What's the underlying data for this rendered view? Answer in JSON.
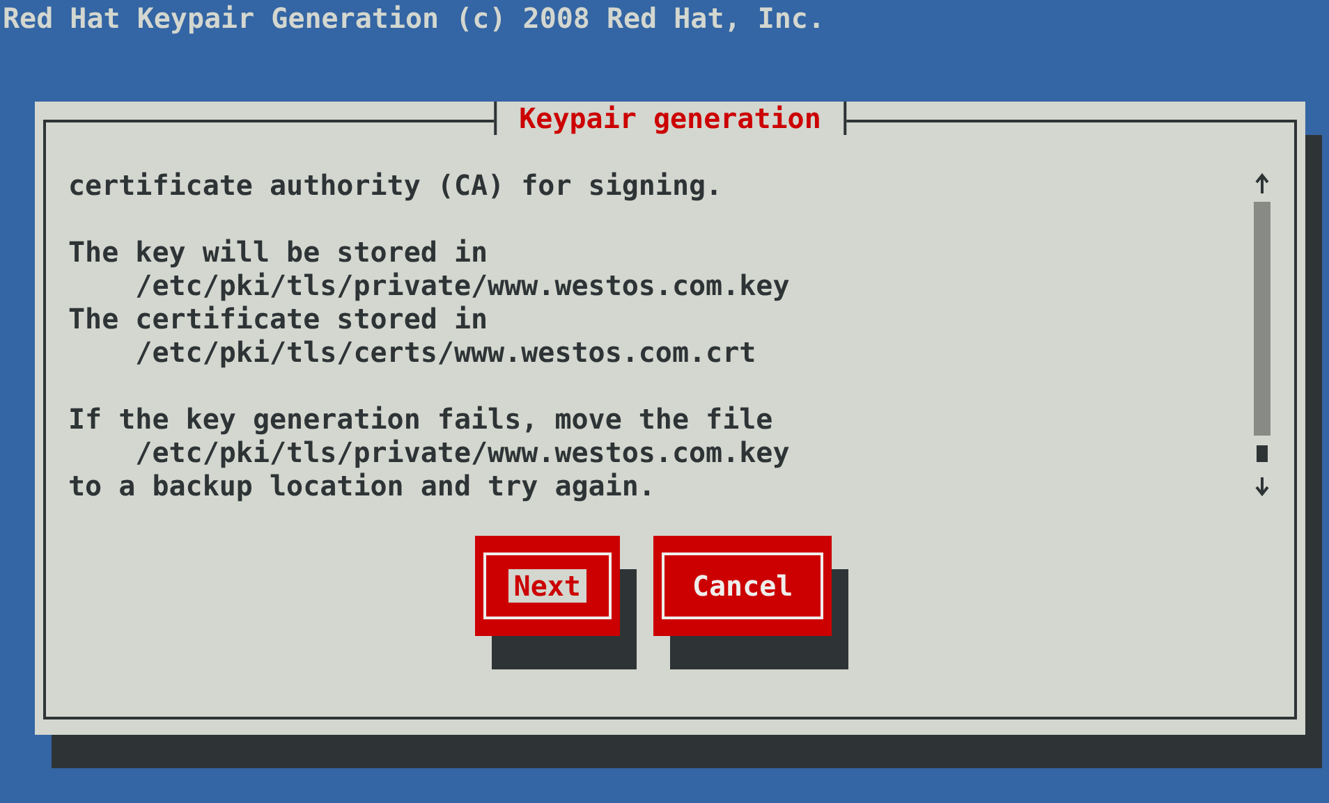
{
  "screen_title": "Red Hat Keypair Generation (c) 2008 Red Hat, Inc.",
  "dialog": {
    "title": "Keypair generation",
    "paragraphs": [
      [
        "certificate authority (CA) for signing."
      ],
      [
        "The key will be stored in",
        "    /etc/pki/tls/private/www.westos.com.key",
        "The certificate stored in",
        "    /etc/pki/tls/certs/www.westos.com.crt"
      ],
      [
        "If the key generation fails, move the file",
        "    /etc/pki/tls/private/www.westos.com.key",
        "to a backup location and try again."
      ]
    ],
    "buttons": [
      {
        "label": "Next",
        "selected": true
      },
      {
        "label": "Cancel",
        "selected": false
      }
    ]
  }
}
